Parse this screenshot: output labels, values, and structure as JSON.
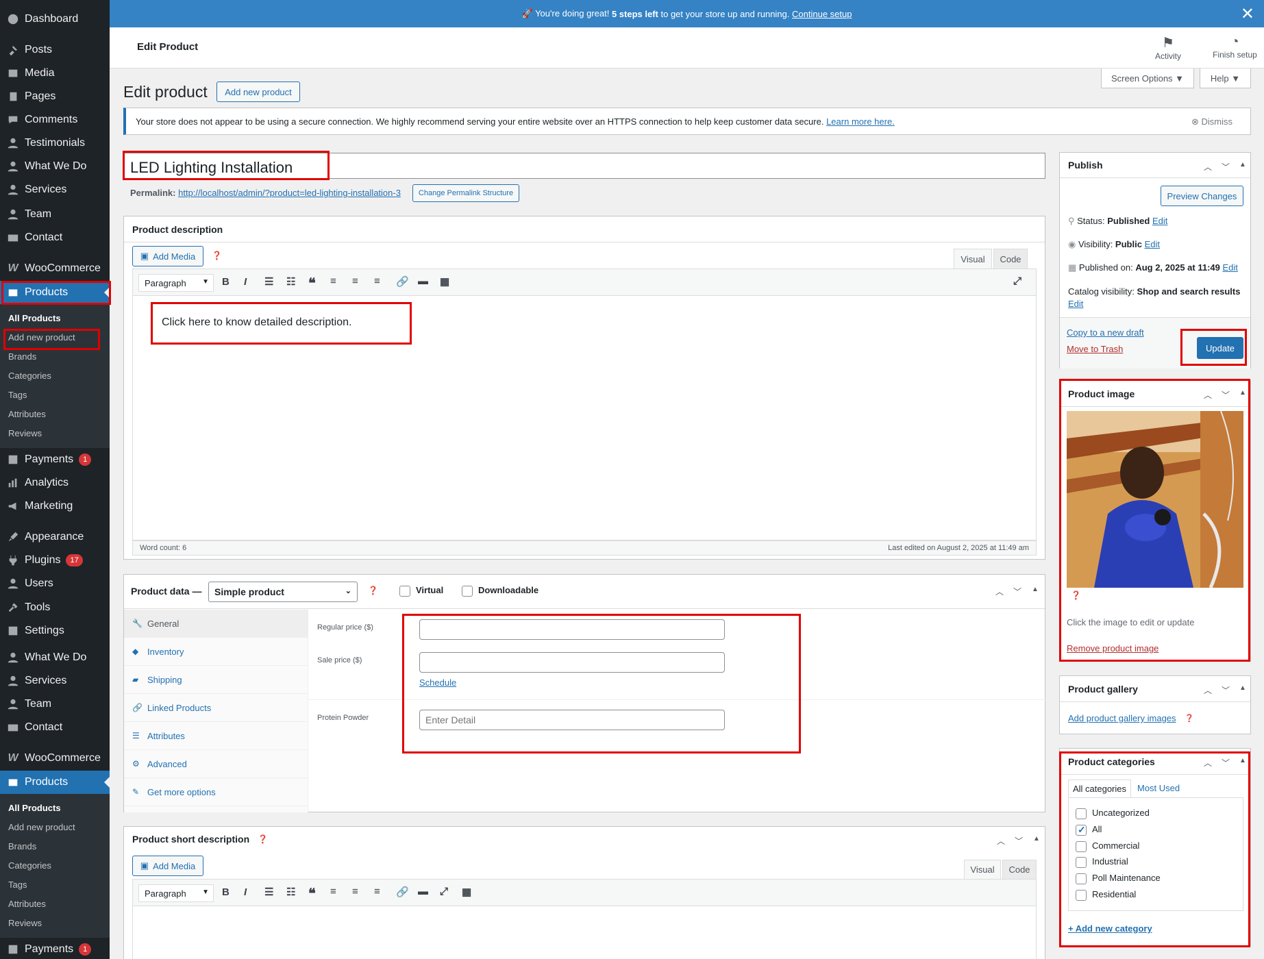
{
  "notice_top": {
    "prefix": "🚀 You're doing great! ",
    "bold": "5 steps left",
    "middle": " to get your store up and running. ",
    "link": "Continue setup"
  },
  "header": {
    "title": "Edit Product",
    "activity": "Activity",
    "finish_setup": "Finish setup"
  },
  "screen_options": "Screen Options ▼",
  "help": "Help ▼",
  "page": {
    "heading": "Edit product",
    "add_new": "Add new product"
  },
  "https_notice": {
    "text": "Your store does not appear to be using a secure connection. We highly recommend serving your entire website over an HTTPS connection to help keep customer data secure. ",
    "link": "Learn more here.",
    "dismiss": "Dismiss"
  },
  "product": {
    "title": "LED Lighting Installation",
    "permalink_label": "Permalink:",
    "permalink_url": "http://localhost/admin/?product=led-lighting-installation-3",
    "change_permalink": "Change Permalink Structure"
  },
  "description": {
    "title": "Product description",
    "add_media": "Add Media",
    "tab_visual": "Visual",
    "tab_code": "Code",
    "format": "Paragraph",
    "content": "Click here to know detailed description.",
    "word_count": "Word count: 6",
    "last_edited": "Last edited on August 2, 2025 at 11:49 am"
  },
  "product_data": {
    "title": "Product data —",
    "type": "Simple product",
    "virtual": "Virtual",
    "downloadable": "Downloadable",
    "tabs": [
      "General",
      "Inventory",
      "Shipping",
      "Linked Products",
      "Attributes",
      "Advanced",
      "Get more options"
    ],
    "regular_price_label": "Regular price ($)",
    "sale_price_label": "Sale price ($)",
    "schedule": "Schedule",
    "protein_label": "Protein Powder",
    "protein_placeholder": "Enter Detail"
  },
  "short_description": {
    "title": "Product short description",
    "add_media": "Add Media",
    "tab_visual": "Visual",
    "tab_code": "Code",
    "format": "Paragraph"
  },
  "publish": {
    "title": "Publish",
    "preview": "Preview Changes",
    "status_label": "Status: ",
    "status": "Published",
    "visibility_label": "Visibility: ",
    "visibility": "Public",
    "published_label": "Published on: ",
    "published": "Aug 2, 2025 at 11:49",
    "catalog_label": "Catalog visibility: ",
    "catalog": "Shop and search results",
    "edit": "Edit",
    "copy": "Copy to a new draft",
    "trash": "Move to Trash",
    "update": "Update"
  },
  "product_image": {
    "title": "Product image",
    "hint": "Click the image to edit or update",
    "remove": "Remove product image"
  },
  "gallery": {
    "title": "Product gallery",
    "add": "Add product gallery images"
  },
  "categories": {
    "title": "Product categories",
    "tab_all": "All categories",
    "tab_most": "Most Used",
    "items": [
      {
        "label": "Uncategorized",
        "checked": false
      },
      {
        "label": "All",
        "checked": true
      },
      {
        "label": "Commercial",
        "checked": false
      },
      {
        "label": "Industrial",
        "checked": false
      },
      {
        "label": "Poll Maintenance",
        "checked": false
      },
      {
        "label": "Residential",
        "checked": false
      }
    ],
    "add_new": "+ Add new category"
  },
  "sidebar": {
    "dashboard": "Dashboard",
    "posts": "Posts",
    "media": "Media",
    "pages": "Pages",
    "comments": "Comments",
    "testimonials": "Testimonials",
    "what_we_do": "What We Do",
    "services": "Services",
    "team": "Team",
    "contact": "Contact",
    "woocommerce": "WooCommerce",
    "products": "Products",
    "sub_products": [
      "All Products",
      "Add new product",
      "Brands",
      "Categories",
      "Tags",
      "Attributes",
      "Reviews"
    ],
    "payments": "Payments",
    "payments_badge": "1",
    "analytics": "Analytics",
    "marketing": "Marketing",
    "appearance": "Appearance",
    "plugins": "Plugins",
    "plugins_badge": "17",
    "users": "Users",
    "tools": "Tools",
    "settings": "Settings"
  },
  "colors": {
    "accent": "#2271b1",
    "sidebar": "#1d2327",
    "highlight": "#e00000",
    "notice": "#3582c4"
  }
}
